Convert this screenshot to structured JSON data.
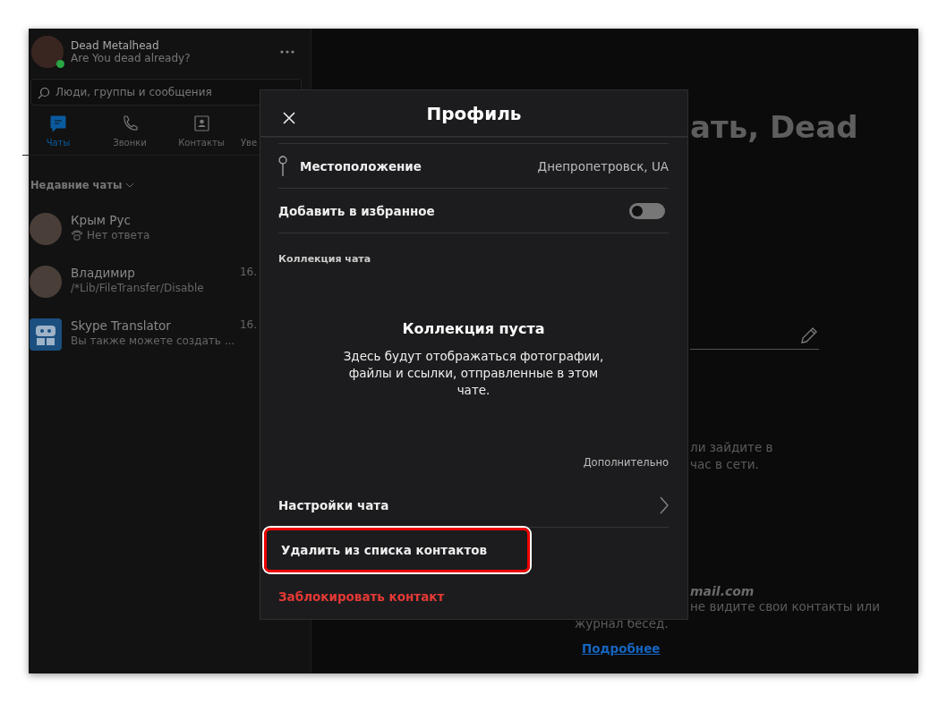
{
  "profile": {
    "name": "Dead Metalhead",
    "status": "Are You dead already?",
    "online": true
  },
  "search": {
    "placeholder": "Люди, группы и сообщения"
  },
  "nav_tabs": [
    {
      "label": "Чаты",
      "kind": "chat",
      "selected": true
    },
    {
      "label": "Звонки",
      "kind": "phone",
      "selected": false
    },
    {
      "label": "Контакты",
      "kind": "contacts",
      "selected": false
    },
    {
      "label": "Уве",
      "kind": "none",
      "selected": false
    }
  ],
  "recent_chats_label": "Недавние чаты",
  "chats": [
    {
      "name": "Крым Рус",
      "preview": "Нет ответа",
      "kind": "photo",
      "call": true
    },
    {
      "name": "Владимир",
      "preview": "/*Lib/FileTransfer/Disable",
      "kind": "photo",
      "call": false,
      "time": "16."
    },
    {
      "name": "Skype Translator",
      "preview": "Вы также можете создать ...",
      "kind": "robot",
      "call": false,
      "time": "16."
    }
  ],
  "main": {
    "heading": "ать, Dead",
    "line_1": "ли зайдите в",
    "line_2": "час в сети.",
    "email": "mail.com",
    "note_1": "не видите свои контакты или",
    "note_2": "журнал бесед.",
    "link": "Подробнее"
  },
  "dialog": {
    "title": "Профиль",
    "location": {
      "label": "Местоположение",
      "value": "Днепропетровск, UA"
    },
    "favorite": {
      "label": "Добавить в избранное",
      "on": false
    },
    "collection": {
      "heading": "Коллекция чата",
      "empty_title": "Коллекция пуста",
      "empty_text": "Здесь будут отображаться фотографии, файлы и ссылки, отправленные в этом чате.",
      "more": "Дополнительно"
    },
    "actions": [
      {
        "label": "Настройки чата",
        "kind": "nav",
        "highlighted": false
      },
      {
        "label": "Удалить из списка контактов",
        "kind": "plain",
        "highlighted": true
      },
      {
        "label": "Заблокировать контакт",
        "kind": "danger",
        "highlighted": false
      }
    ]
  }
}
